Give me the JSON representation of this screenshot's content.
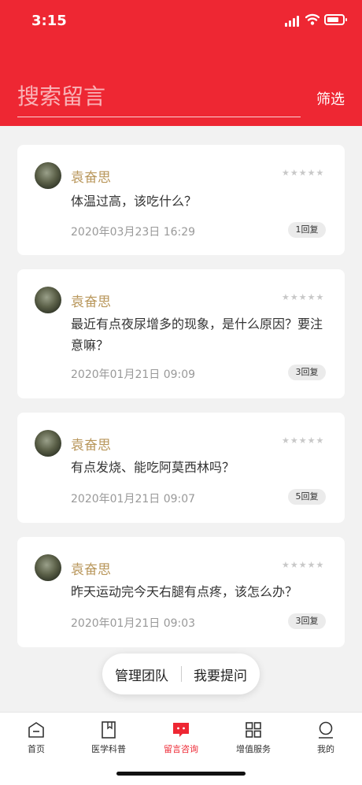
{
  "status_bar": {
    "time": "3:15"
  },
  "search": {
    "placeholder": "搜索留言",
    "filter_label": "筛选"
  },
  "messages": [
    {
      "author": "袁奋思",
      "rating": 0,
      "question": "体温过高，该吃什么？",
      "date": "2020年03月23日 16:29",
      "replies": "1回复"
    },
    {
      "author": "袁奋思",
      "rating": 0,
      "question": "最近有点夜尿增多的现象，是什么原因？要注意嘛？",
      "date": "2020年01月21日 09:09",
      "replies": "3回复"
    },
    {
      "author": "袁奋思",
      "rating": 0,
      "question": "有点发烧、能吃阿莫西林吗？",
      "date": "2020年01月21日 09:07",
      "replies": "5回复"
    },
    {
      "author": "袁奋思",
      "rating": 0,
      "question": "昨天运动完今天右腿有点疼，该怎么办？",
      "date": "2020年01月21日 09:03",
      "replies": "3回复"
    }
  ],
  "floating": {
    "team": "管理团队",
    "ask": "我要提问"
  },
  "tabs": [
    {
      "label": "首页",
      "icon": "home-icon"
    },
    {
      "label": "医学科普",
      "icon": "book-icon"
    },
    {
      "label": "留言咨询",
      "icon": "chat-icon",
      "active": true
    },
    {
      "label": "增值服务",
      "icon": "grid-icon"
    },
    {
      "label": "我的",
      "icon": "user-icon"
    }
  ],
  "colors": {
    "brand": "#ee2733",
    "author": "#b8965a"
  }
}
